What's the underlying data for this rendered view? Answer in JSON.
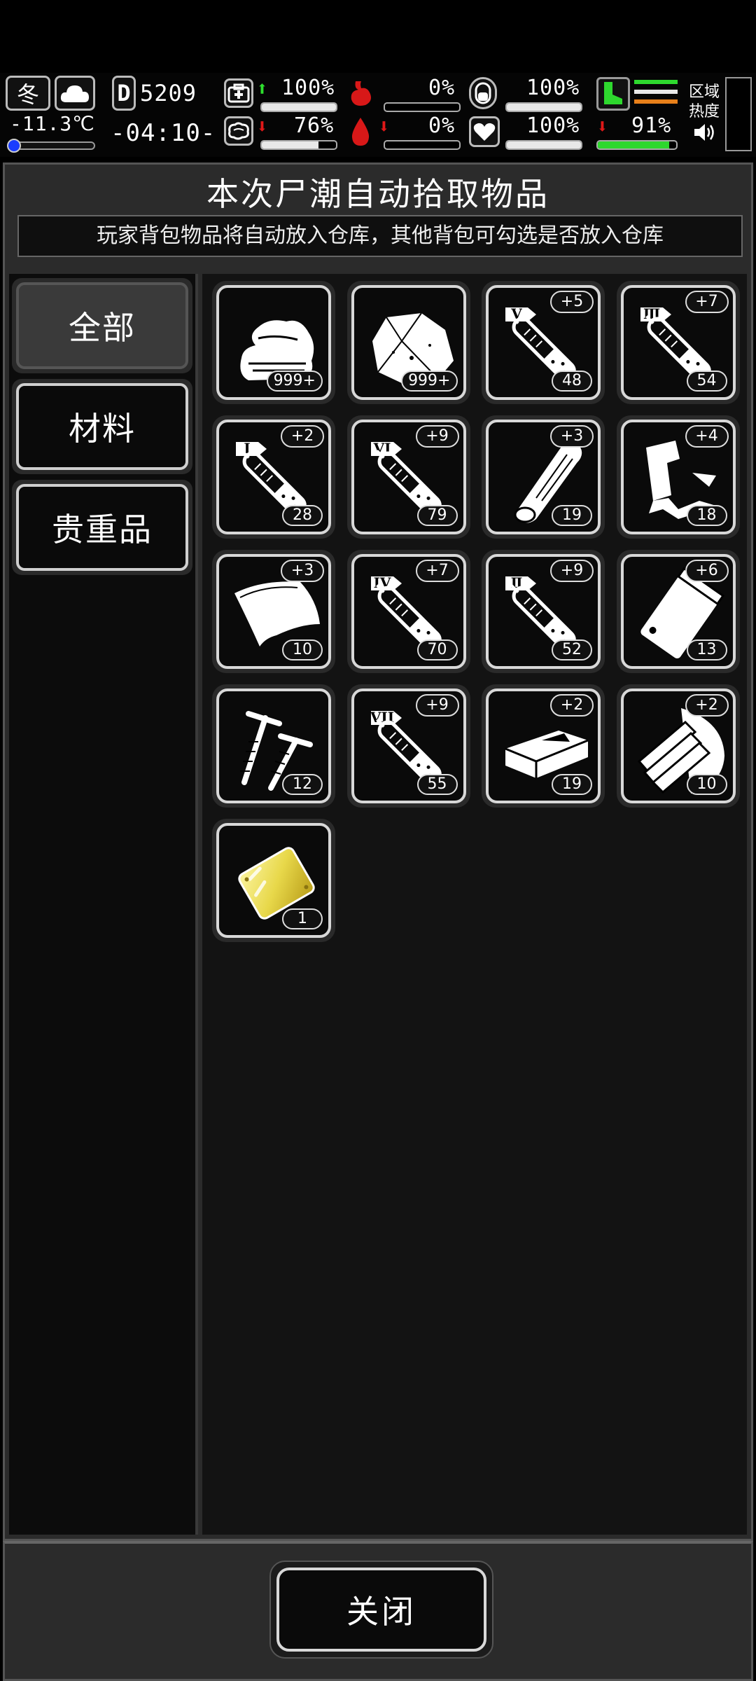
{
  "status": {
    "season": "冬",
    "temperature": "-11.3℃",
    "day": "5209",
    "time": "-04:10-",
    "health_pct": "100%",
    "stomach_pct": "0%",
    "stamina_pct": "100%",
    "mental_pct": "76%",
    "thirst_pct": "0%",
    "heart_pct": "100%",
    "legs_pct": "91%",
    "zone_label": "区域热度",
    "bar_levels": {
      "health": 1.0,
      "stomach": 0.0,
      "stamina": 1.0,
      "mental": 0.76,
      "thirst": 0.0,
      "heart": 1.0,
      "legs": 0.91
    }
  },
  "panel": {
    "title": "本次尸潮自动拾取物品",
    "subtitle": "玩家背包物品将自动放入仓库，其他背包可勾选是否放入仓库"
  },
  "tabs": [
    {
      "label": "全部",
      "active": true
    },
    {
      "label": "材料",
      "active": false
    },
    {
      "label": "贵重品",
      "active": false
    }
  ],
  "items": [
    {
      "icon": "cloth-icon",
      "count": "999+",
      "bonus": ""
    },
    {
      "icon": "ore-rock-icon",
      "count": "999+",
      "bonus": ""
    },
    {
      "icon": "potion-tube-v-icon",
      "roman": "V",
      "count": "48",
      "bonus": "+5"
    },
    {
      "icon": "potion-tube-iii-icon",
      "roman": "Ⅲ",
      "count": "54",
      "bonus": "+7"
    },
    {
      "icon": "potion-tube-i-icon",
      "roman": "I",
      "count": "28",
      "bonus": "+2"
    },
    {
      "icon": "potion-tube-vi-icon",
      "roman": "VI",
      "count": "79",
      "bonus": "+9"
    },
    {
      "icon": "wood-log-icon",
      "count": "19",
      "bonus": "+3"
    },
    {
      "icon": "scrap-metal-icon",
      "count": "18",
      "bonus": "+4"
    },
    {
      "icon": "leather-sheet-icon",
      "count": "10",
      "bonus": "+3"
    },
    {
      "icon": "potion-tube-iv-icon",
      "roman": "IV",
      "count": "70",
      "bonus": "+7"
    },
    {
      "icon": "potion-tube-ii-icon",
      "roman": "Ⅱ",
      "count": "52",
      "bonus": "+9"
    },
    {
      "icon": "plastic-bag-icon",
      "count": "13",
      "bonus": "+6"
    },
    {
      "icon": "screws-icon",
      "count": "12",
      "bonus": ""
    },
    {
      "icon": "potion-tube-vii-icon",
      "roman": "VII",
      "count": "55",
      "bonus": "+9"
    },
    {
      "icon": "brick-block-icon",
      "count": "19",
      "bonus": "+2"
    },
    {
      "icon": "wood-planks-icon",
      "count": "10",
      "bonus": "+2"
    },
    {
      "icon": "gold-plate-icon",
      "count": "1",
      "bonus": ""
    }
  ],
  "footer": {
    "close_label": "关闭"
  },
  "colors": {
    "background": "#000000",
    "panel": "#2b2b2b",
    "grid": "#131313",
    "gold": "#e8d84a",
    "health_up": "#2ee02e",
    "warning": "#e01818"
  }
}
